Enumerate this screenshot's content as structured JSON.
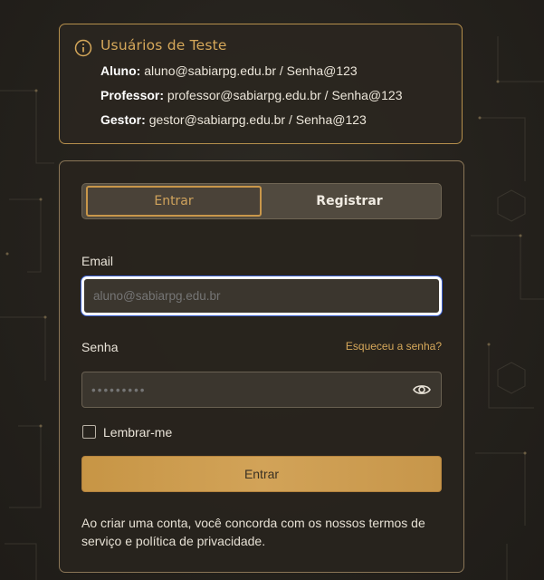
{
  "info": {
    "title": "Usuários de Teste",
    "credentials": [
      {
        "role": "Aluno:",
        "value": "aluno@sabiarpg.edu.br / Senha@123"
      },
      {
        "role": "Professor:",
        "value": "professor@sabiarpg.edu.br / Senha@123"
      },
      {
        "role": "Gestor:",
        "value": "gestor@sabiarpg.edu.br / Senha@123"
      }
    ]
  },
  "tabs": {
    "login": "Entrar",
    "register": "Registrar"
  },
  "form": {
    "email_label": "Email",
    "email_placeholder": "aluno@sabiarpg.edu.br",
    "password_label": "Senha",
    "forgot_link": "Esqueceu a senha?",
    "password_placeholder": "•••••••••",
    "remember_label": "Lembrar-me",
    "submit_label": "Entrar",
    "terms_text": "Ao criar uma conta, você concorda com os nossos termos de serviço e política de privacidade."
  },
  "colors": {
    "accent": "#d6a85a",
    "background": "#25221d",
    "focus_ring": "#3a5fd0"
  },
  "icons": {
    "info": "info-circle-icon",
    "password_toggle": "eye-icon"
  }
}
